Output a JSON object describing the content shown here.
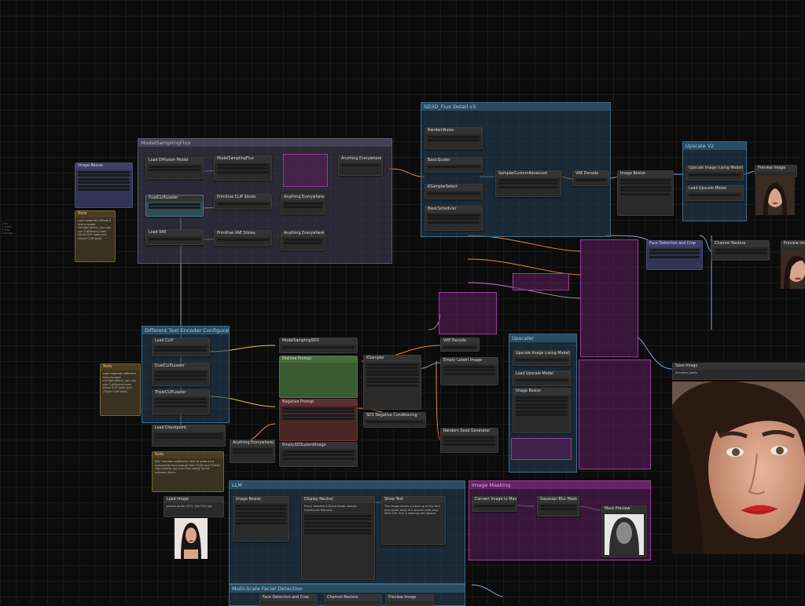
{
  "canvas": {
    "side_info": [
      "1 fps",
      "0 nodes",
      "0 links",
      "0 groups"
    ]
  },
  "groups": {
    "model_sampling": "ModelSamplingFlux",
    "sd3_flux": "SD3D_Flux Detail v3",
    "upscale_v2": "Upscale V2",
    "text_encoder": "Different Text Encoder Configurations",
    "upscaler": "Upscaler",
    "llm": "LLM",
    "image_masking": "Image Masking",
    "multi_scale": "Multi-Scale Facial Detection"
  },
  "nodes": {
    "image_resize": "Image Resize",
    "note1": "Note",
    "note1_text": "Load separate different text encoder configurations, you can use 3 different main (Dual CLIP load) and (Triple CLIP load).",
    "load_diffusion": "Load Diffusion Model",
    "dualclip1": "DualCLIPLoader",
    "load_vae": "Load VAE",
    "model_sampling_flux": "ModelSamplingFlux",
    "prim_clip": "Primitive CLIP Stores",
    "prim_vae": "Primitive VAE Stores",
    "anything_everywhere": "Anything Everywhere",
    "anything_everywhere3": "Anything Everywhere3",
    "random_noise": "RandomNoise",
    "basic_guider": "BasicGuider",
    "ksampler_select": "KSamplerSelect",
    "basic_scheduler": "BasicScheduler",
    "sampler_custom": "SamplerCustomAdvanced",
    "vae_decode": "VAE Decode",
    "image_resize2": "Image Resize",
    "upscale_image": "Upscale Image (using Model)",
    "load_upscale": "Load Upscale Model",
    "preview_image": "Preview Image",
    "face_detect": "Face Detection and Crop",
    "channel_restore": "Channel Restore",
    "load_clip": "Load CLIP",
    "dualclip2": "DualCLIPLoader",
    "tripleclip": "TripleCLIPLoader",
    "model_sampling_sd3": "ModelSamplingSD3",
    "positive_prompt": "Positive Prompt",
    "negative_prompt": "Negative Prompt",
    "ksampler": "KSampler",
    "vae_decode2": "VAE Decode",
    "empty_latent": "Empty Latent Image",
    "sd3_neg": "SD3 Negative Conditioning",
    "random_seed": "Random Seed Generator",
    "upscale_image2": "Upscale Image (using Model)",
    "load_upscale2": "Load Upscale Model",
    "image_resize3": "Image Resize",
    "load_checkpoint": "Load Checkpoint",
    "note2": "Note",
    "note3": "Note",
    "note3_text": "SD3 requires additional clips to produce a reasonable text prompt then FLUX and TRIPLE clip models; you can then easily blend between them.",
    "empty_sd3": "EmptySD3LatentImage",
    "load_image": "Load Image",
    "load_image_file": "pexels-photo-3971 1087155.jpg",
    "image_resize4": "Image Resize",
    "display_neutral": "Display Neutral",
    "show_text": "Show Text",
    "display_text": "Every detailed & Blend Mode realistic impressive features...",
    "show_text_body": "The image shows a close-up of the face and upper body of a woman with long dark hair. She is wearing red lipstick.",
    "convert_mask": "Convert Image to Mask",
    "gaussian_blur": "Gaussian Blur Mask",
    "mask_preview": "Mask Preview",
    "save_image": "Save Image",
    "save_image_prefix": "filename_prefix",
    "face_detect2": "Face Detection and Crop",
    "channel_restore2": "Channel Restore",
    "preview_image2": "Preview Image"
  },
  "colors": {
    "accent_blue": "#3c6a8a",
    "accent_purple": "#9a3a9a",
    "note": "#7a6430",
    "wire_orange": "#e08a4a",
    "wire_blue": "#7aa7d6"
  }
}
